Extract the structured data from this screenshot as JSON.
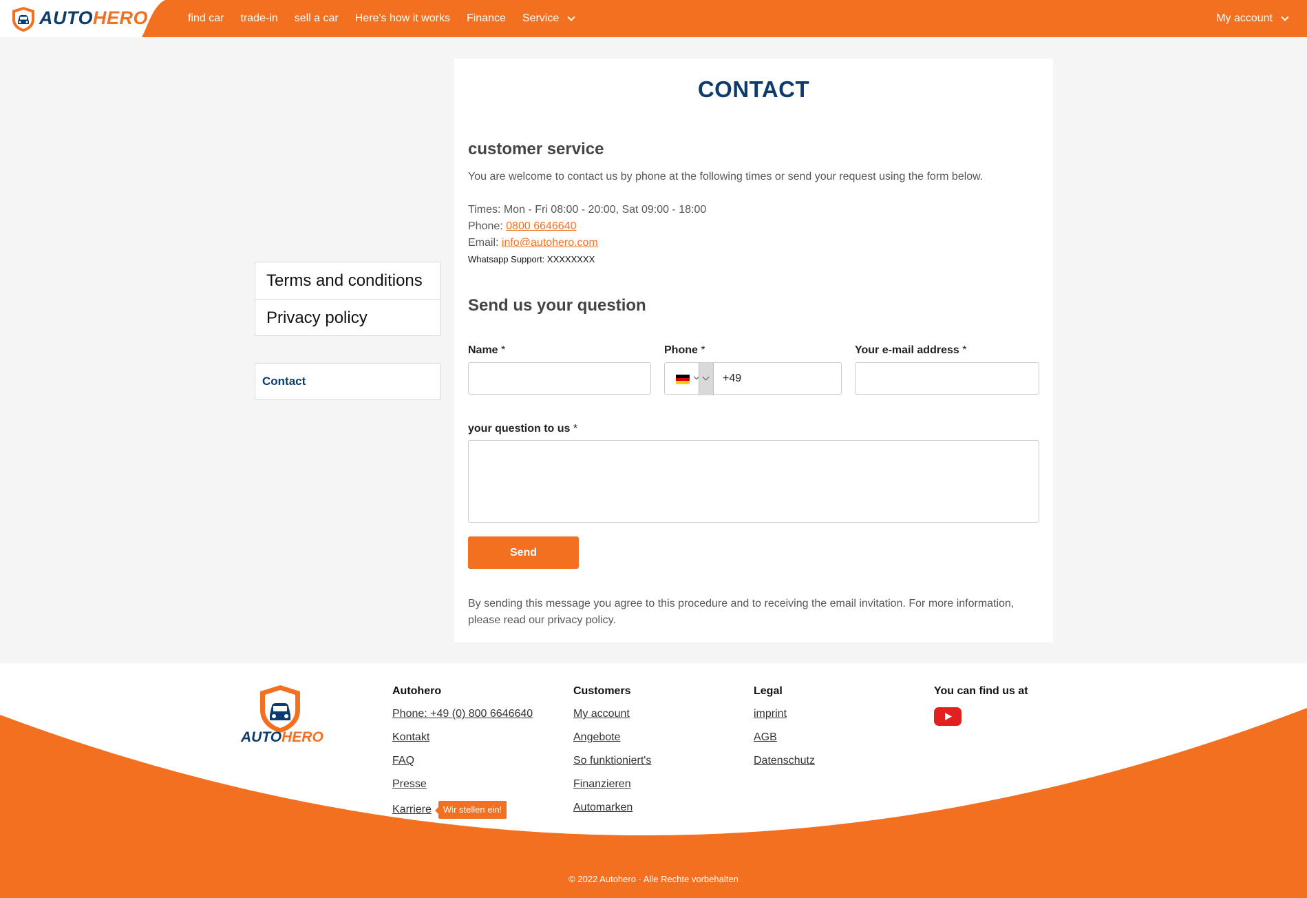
{
  "header": {
    "brand_part1": "AUTO",
    "brand_part2": "HERO",
    "nav": [
      "find car",
      "trade-in",
      "sell a car",
      "Here's how it works",
      "Finance",
      "Service"
    ],
    "account_label": "My account"
  },
  "sidebar": {
    "legal_links": [
      "Terms and conditions",
      "Privacy policy"
    ],
    "contact_label": "Contact"
  },
  "main": {
    "title": "CONTACT",
    "customer_service_heading": "customer service",
    "intro": "You are welcome to contact us by phone at the following times or send your request using the form below.",
    "times": "Times: Mon - Fri 08:00 - 20:00, Sat 09:00 - 18:00",
    "phone_prefix": "Phone: ",
    "phone": "0800 6646640",
    "email_prefix": "Email: ",
    "email": "info@autohero.com",
    "whatsapp": "Whatsapp Support: XXXXXXXX",
    "form_heading": "Send us your question",
    "form": {
      "name_label": "Name",
      "phone_label": "Phone",
      "email_label": "Your e-mail address",
      "question_label": "your question to us",
      "required_mark": "*",
      "phone_code_value": "+49",
      "name_value": "",
      "email_value": "",
      "question_value": "",
      "send_label": "Send"
    },
    "consent": "By sending this message you agree to this procedure and to receiving the email invitation. For more information, please read our privacy policy."
  },
  "footer": {
    "brand_part1": "AUTO",
    "brand_part2": "HERO",
    "columns": [
      {
        "heading": "Autohero",
        "links": [
          "Phone: +49 (0) 800 6646640",
          "Kontakt",
          "FAQ",
          "Presse",
          "Karriere"
        ]
      },
      {
        "heading": "Customers",
        "links": [
          "My account",
          "Angebote",
          "So funktioniert's",
          "Finanzieren",
          "Automarken"
        ]
      },
      {
        "heading": "Legal",
        "links": [
          "imprint",
          "AGB",
          "Datenschutz"
        ]
      },
      {
        "heading": "You can find us at",
        "links": []
      }
    ],
    "hiring_badge": "Wir stellen ein!",
    "social_icon": "youtube-icon",
    "copyright": "© 2022 Autohero · Alle Rechte vorbehalten"
  },
  "colors": {
    "brand_orange": "#f37021",
    "brand_navy": "#0d3b6b",
    "page_bg": "#f5f5f5"
  }
}
